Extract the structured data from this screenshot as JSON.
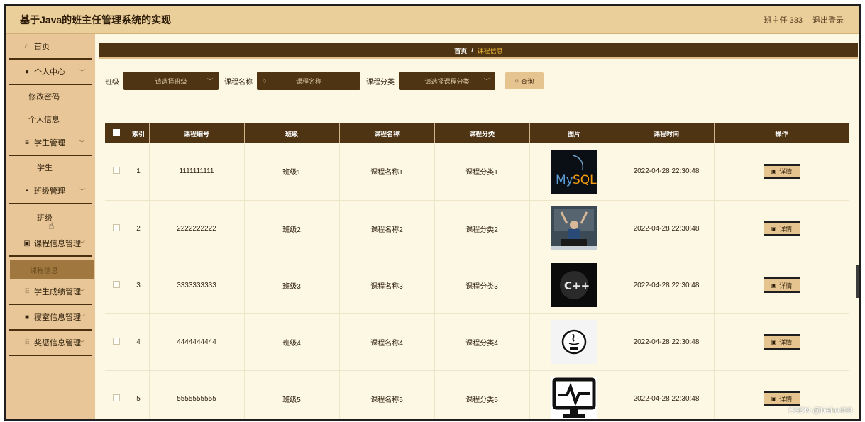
{
  "app_title": "基于Java的班主任管理系统的实现",
  "header": {
    "user": "班主任 333",
    "logout": "退出登录"
  },
  "sidebar": {
    "home": "首页",
    "personal_center": "个人中心",
    "change_password": "修改密码",
    "personal_info": "个人信息",
    "student_mgmt": "学生管理",
    "student": "学生",
    "class_mgmt": "班级管理",
    "class": "班级",
    "course_mgmt": "课程信息管理",
    "course_info": "课程信息",
    "grade_mgmt": "学生成绩管理",
    "dorm_mgmt": "寝室信息管理",
    "award_mgmt": "奖惩信息管理"
  },
  "breadcrumb": {
    "home": "首页",
    "sep": "/",
    "current": "课程信息"
  },
  "filters": {
    "class_label": "班级",
    "class_placeholder": "请选择班级",
    "name_label": "课程名称",
    "name_placeholder": "课程名称",
    "category_label": "课程分类",
    "category_placeholder": "请选择课程分类",
    "query_button": "查询"
  },
  "table": {
    "headers": {
      "index": "索引",
      "code": "课程编号",
      "class": "班级",
      "name": "课程名称",
      "category": "课程分类",
      "image": "图片",
      "time": "课程时间",
      "action": "操作"
    },
    "detail_label": "详情",
    "rows": [
      {
        "index": "1",
        "code": "1111111111",
        "class": "班级1",
        "name": "课程名称1",
        "category": "课程分类1",
        "time": "2022-04-28 22:30:48",
        "image": "mysql-logo"
      },
      {
        "index": "2",
        "code": "2222222222",
        "class": "班级2",
        "name": "课程名称2",
        "category": "课程分类2",
        "time": "2022-04-28 22:30:48",
        "image": "coder-photo"
      },
      {
        "index": "3",
        "code": "3333333333",
        "class": "班级3",
        "name": "课程名称3",
        "category": "课程分类3",
        "time": "2022-04-28 22:30:48",
        "image": "cpp-logo"
      },
      {
        "index": "4",
        "code": "4444444444",
        "class": "班级4",
        "name": "课程名称4",
        "category": "课程分类4",
        "time": "2022-04-28 22:30:48",
        "image": "java-logo"
      },
      {
        "index": "5",
        "code": "5555555555",
        "class": "班级5",
        "name": "课程名称5",
        "category": "课程分类5",
        "time": "2022-04-28 22:30:48",
        "image": "monitor-icon"
      }
    ]
  },
  "watermark": "CSDN @bishe409",
  "colors": {
    "accent_dark": "#4e3412",
    "sidebar_bg": "#e8c697",
    "topbar_bg": "#ebcf9b",
    "content_bg": "#fdf8e4",
    "breadcrumb_current": "#f0b93a"
  }
}
